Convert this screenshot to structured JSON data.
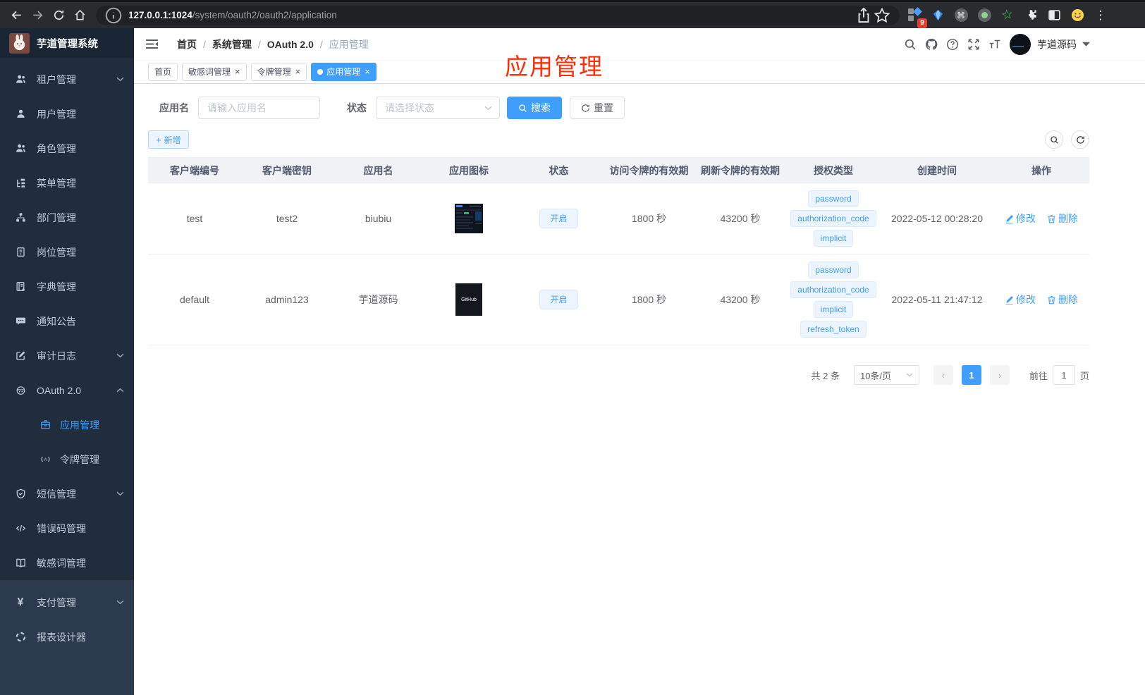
{
  "browser": {
    "url_host": "127.0.0.1:1024",
    "url_path": "/system/oauth2/oauth2/application",
    "extension_badge": "9",
    "icons": [
      "back",
      "forward",
      "reload",
      "home",
      "info",
      "share",
      "bookmark-star",
      "extensions-grid",
      "gem",
      "command-circle",
      "record-circle",
      "green-star",
      "puzzle",
      "split-view",
      "emoji-avatar",
      "kebab-menu"
    ]
  },
  "sidebar": {
    "logo_title": "芋道管理系统",
    "items": [
      {
        "label": "租户管理",
        "icon": "users-icon",
        "chevron": "down"
      },
      {
        "label": "用户管理",
        "icon": "user-icon"
      },
      {
        "label": "角色管理",
        "icon": "users-icon"
      },
      {
        "label": "菜单管理",
        "icon": "tree-menu-icon"
      },
      {
        "label": "部门管理",
        "icon": "org-chart-icon"
      },
      {
        "label": "岗位管理",
        "icon": "id-badge-icon"
      },
      {
        "label": "字典管理",
        "icon": "dictionary-book-icon"
      },
      {
        "label": "通知公告",
        "icon": "message-icon"
      },
      {
        "label": "审计日志",
        "icon": "audit-log-icon",
        "chevron": "down"
      },
      {
        "label": "OAuth 2.0",
        "icon": "robot-icon",
        "chevron": "up"
      },
      {
        "label": "应用管理",
        "icon": "briefcase-icon",
        "submenu": true,
        "active": true
      },
      {
        "label": "令牌管理",
        "icon": "token-signal-icon",
        "submenu": true
      },
      {
        "label": "短信管理",
        "icon": "shield-check-icon",
        "chevron": "down"
      },
      {
        "label": "错误码管理",
        "icon": "code-icon"
      },
      {
        "label": "敏感词管理",
        "icon": "open-book-icon"
      },
      {
        "label": "支付管理",
        "icon": "yen-icon",
        "chevron": "down"
      },
      {
        "label": "报表设计器",
        "icon": "report-wheel-icon"
      }
    ]
  },
  "header": {
    "breadcrumbs": [
      "首页",
      "系统管理",
      "OAuth 2.0",
      "应用管理"
    ],
    "right_icons": [
      "search-icon",
      "github-icon",
      "help-icon",
      "fullscreen-icon",
      "font-size-icon"
    ],
    "username": "芋道源码"
  },
  "annotation": {
    "text": "应用管理",
    "color": "#fa2f08"
  },
  "tabs": [
    {
      "label": "首页",
      "closable": false,
      "active": false
    },
    {
      "label": "敏感词管理",
      "closable": true,
      "active": false
    },
    {
      "label": "令牌管理",
      "closable": true,
      "active": false
    },
    {
      "label": "应用管理",
      "closable": true,
      "active": true
    }
  ],
  "filters": {
    "name_label": "应用名",
    "name_placeholder": "请输入应用名",
    "status_label": "状态",
    "status_placeholder": "请选择状态",
    "search_label": "搜索",
    "reset_label": "重置"
  },
  "toolbar": {
    "add_label": "新增"
  },
  "table": {
    "columns": [
      "客户端编号",
      "客户端密钥",
      "应用名",
      "应用图标",
      "状态",
      "访问令牌的有效期",
      "刷新令牌的有效期",
      "授权类型",
      "创建时间",
      "操作"
    ],
    "rows": [
      {
        "client_id": "test",
        "client_secret": "test2",
        "app_name": "biubiu",
        "app_icon": "dark-dashboard-thumbnail",
        "status": "开启",
        "access_token_ttl": "1800 秒",
        "refresh_token_ttl": "43200 秒",
        "grant_types": [
          "password",
          "authorization_code",
          "implicit"
        ],
        "created_at": "2022-05-12 00:28:20",
        "edit_label": "修改",
        "delete_label": "删除"
      },
      {
        "client_id": "default",
        "client_secret": "admin123",
        "app_name": "芋道源码",
        "app_icon": "github-logo-thumbnail",
        "app_icon_text": "GitHub",
        "status": "开启",
        "access_token_ttl": "1800 秒",
        "refresh_token_ttl": "43200 秒",
        "grant_types": [
          "password",
          "authorization_code",
          "implicit",
          "refresh_token"
        ],
        "created_at": "2022-05-11 21:47:12",
        "edit_label": "修改",
        "delete_label": "删除"
      }
    ]
  },
  "pagination": {
    "total_text": "共 2 条",
    "page_size_text": "10条/页",
    "current_page": "1",
    "goto_label": "前往",
    "goto_value": "1",
    "page_unit": "页"
  },
  "colors": {
    "primary": "#409eff",
    "sidebar_bg": "#1f2d3d",
    "tag_bg": "#ecf5ff",
    "tag_border": "#d9ecff",
    "annotation_red": "#fa2f08"
  }
}
